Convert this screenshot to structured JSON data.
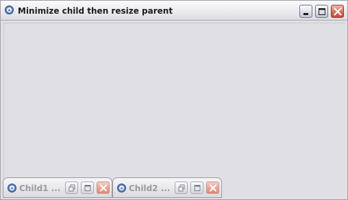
{
  "window": {
    "title": "Minimize child then resize parent",
    "icon": "app-logo-icon",
    "controls": [
      "minimize-icon",
      "maximize-icon",
      "close-icon"
    ]
  },
  "iconified_frames": [
    {
      "title": "Child1 ...",
      "icon": "app-logo-icon",
      "controls": [
        "restore-icon",
        "maximize-icon",
        "close-icon"
      ]
    },
    {
      "title": "Child2 ...",
      "icon": "app-logo-icon",
      "controls": [
        "restore-icon",
        "maximize-icon",
        "close-icon"
      ]
    }
  ],
  "colors": {
    "desktop_background": "#e0dfe4",
    "close_button": "#d9523f",
    "title_text": "#1c1c1c",
    "disabled_text": "#9b9aa1"
  }
}
